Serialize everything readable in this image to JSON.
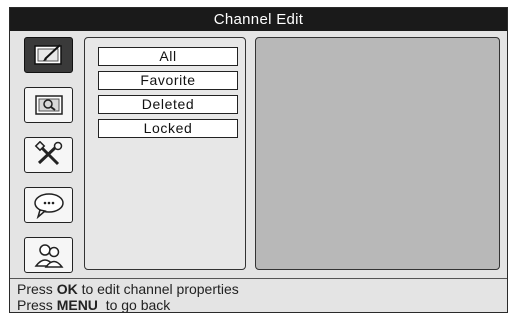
{
  "title": "Channel Edit",
  "sidebar": {
    "icons": [
      {
        "name": "channel-edit-icon",
        "selected": true
      },
      {
        "name": "picture-search-icon",
        "selected": false
      },
      {
        "name": "tools-icon",
        "selected": false
      },
      {
        "name": "speech-bubble-icon",
        "selected": false
      },
      {
        "name": "users-icon",
        "selected": false
      }
    ]
  },
  "menu": {
    "items": [
      "All",
      "Favorite",
      "Deleted",
      "Locked"
    ]
  },
  "help": {
    "line1": {
      "prefix": "Press ",
      "key": "OK",
      "suffix": " to edit channel properties"
    },
    "line2": {
      "prefix": "Press ",
      "key": "MENU",
      "suffix": "  to go back"
    }
  },
  "colors": {
    "title_bg": "#1a1a1a",
    "panel_bg": "#e4e4e4",
    "preview_bg": "#b8b8b8",
    "selected_icon_bg": "#3a3a3a"
  }
}
